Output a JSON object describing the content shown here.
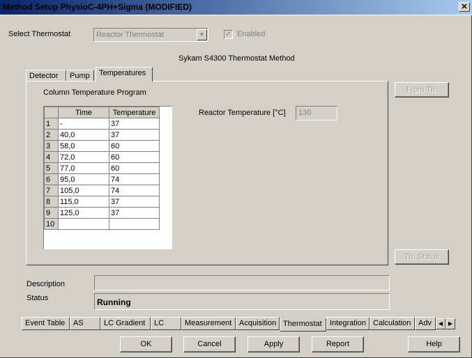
{
  "window": {
    "title": "Method Setup PhysioC-4PH+Sigma (MODIFIED)",
    "close_glyph": "✕"
  },
  "thermostat": {
    "select_label": "Select Thermostat",
    "selected_value": "Reactor Thermostat",
    "enabled_label": "Enabled",
    "enabled_checked": true,
    "method_title": "Sykam S4300 Thermostat Method"
  },
  "tabs": [
    {
      "label": "Detector",
      "active": false
    },
    {
      "label": "Pump",
      "active": false
    },
    {
      "label": "Temperatures",
      "active": true
    }
  ],
  "program": {
    "heading": "Column Temperature Program",
    "columns": [
      "Time",
      "Temperature"
    ],
    "rows": [
      {
        "n": "1",
        "time": "-",
        "temp": "37"
      },
      {
        "n": "2",
        "time": "40,0",
        "temp": "37"
      },
      {
        "n": "3",
        "time": "58,0",
        "temp": "60"
      },
      {
        "n": "4",
        "time": "72,0",
        "temp": "60"
      },
      {
        "n": "5",
        "time": "77,0",
        "temp": "60"
      },
      {
        "n": "6",
        "time": "95,0",
        "temp": "74"
      },
      {
        "n": "7",
        "time": "105,0",
        "temp": "74"
      },
      {
        "n": "8",
        "time": "115,0",
        "temp": "37"
      },
      {
        "n": "9",
        "time": "125,0",
        "temp": "37"
      },
      {
        "n": "10",
        "time": "",
        "temp": ""
      }
    ]
  },
  "reactor": {
    "label": "Reactor Temperature [°C]",
    "value": "130"
  },
  "side_buttons": {
    "from_th": "From Th.",
    "th_status": "Th. Status"
  },
  "info": {
    "description_label": "Description",
    "description_value": "",
    "status_label": "Status",
    "status_value": "Running"
  },
  "bottom_tabs": [
    {
      "label": "Event Table",
      "active": false
    },
    {
      "label": "AS",
      "active": false
    },
    {
      "label": "LC Gradient",
      "active": false
    },
    {
      "label": "LC",
      "active": false
    },
    {
      "label": "Measurement",
      "active": false
    },
    {
      "label": "Acquisition",
      "active": false
    },
    {
      "label": "Thermostat",
      "active": true
    },
    {
      "label": "Integration",
      "active": false
    },
    {
      "label": "Calculation",
      "active": false
    },
    {
      "label": "Adv",
      "active": false
    }
  ],
  "footer_buttons": {
    "ok": "OK",
    "cancel": "Cancel",
    "apply": "Apply",
    "report": "Report",
    "help": "Help"
  },
  "icons": {
    "combo_arrow": "chevron-down-icon",
    "scroll_left": "arrow-left-icon",
    "scroll_right": "arrow-right-icon"
  }
}
